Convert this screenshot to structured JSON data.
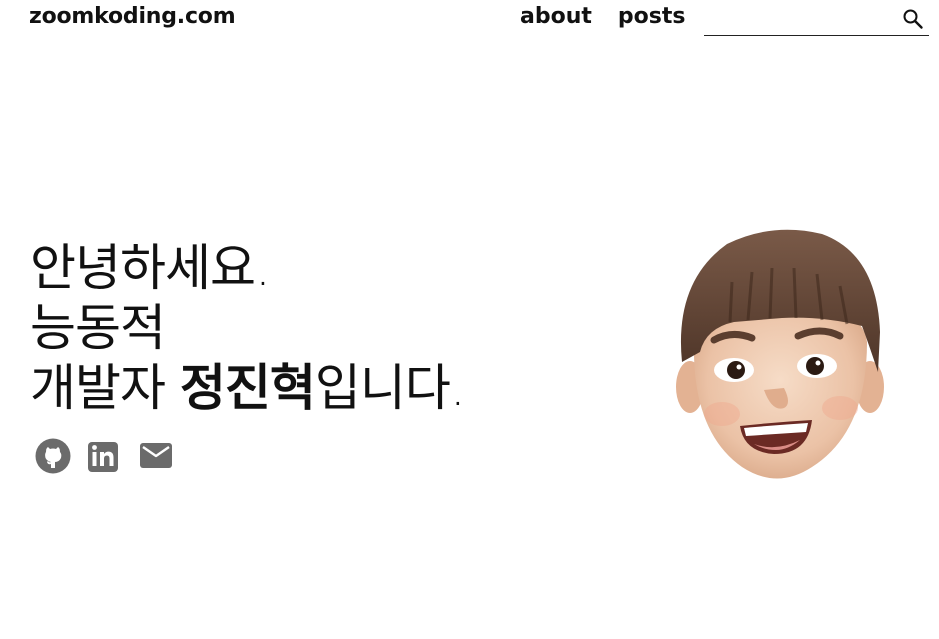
{
  "header": {
    "logo": "zoomkoding.com",
    "nav": [
      {
        "label": "about"
      },
      {
        "label": "posts"
      }
    ],
    "search": {
      "value": "",
      "placeholder": "",
      "icon": "search-icon"
    }
  },
  "hero": {
    "line1": "안녕하세요.",
    "line2": "능동적",
    "line3_prefix": "개발자 ",
    "line3_name": "정진혁",
    "line3_suffix": "입니다."
  },
  "socials": [
    {
      "icon": "github-icon"
    },
    {
      "icon": "linkedin-icon"
    },
    {
      "icon": "email-icon"
    }
  ],
  "colors": {
    "text": "#111111",
    "icon": "#6b6b6b",
    "background": "#ffffff"
  }
}
